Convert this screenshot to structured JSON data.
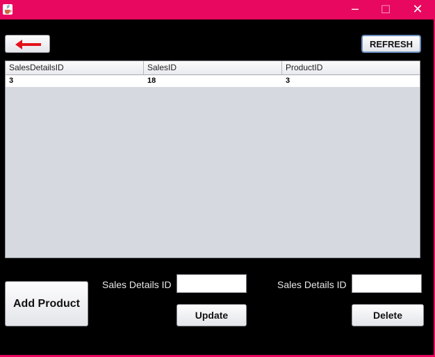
{
  "window": {
    "minimize_glyph": "─",
    "maximize_glyph": "☐",
    "close_glyph": "✕",
    "icon": "java-cup-icon"
  },
  "toolbar": {
    "back_icon": "back-arrow-icon",
    "refresh_label": "REFRESH"
  },
  "table": {
    "columns": [
      "SalesDetailsID",
      "SalesID",
      "ProductID"
    ],
    "rows": [
      [
        "3",
        "18",
        "3"
      ]
    ]
  },
  "form": {
    "add_label": "Add Product",
    "update_field_label": "Sales Details ID",
    "update_field_value": "",
    "update_button": "Update",
    "delete_field_label": "Sales Details ID",
    "delete_field_value": "",
    "delete_button": "Delete"
  },
  "colors": {
    "titlebar": "#e8085f",
    "background": "#000000",
    "table_bg": "#d6d9df",
    "arrow": "#e3121a"
  }
}
